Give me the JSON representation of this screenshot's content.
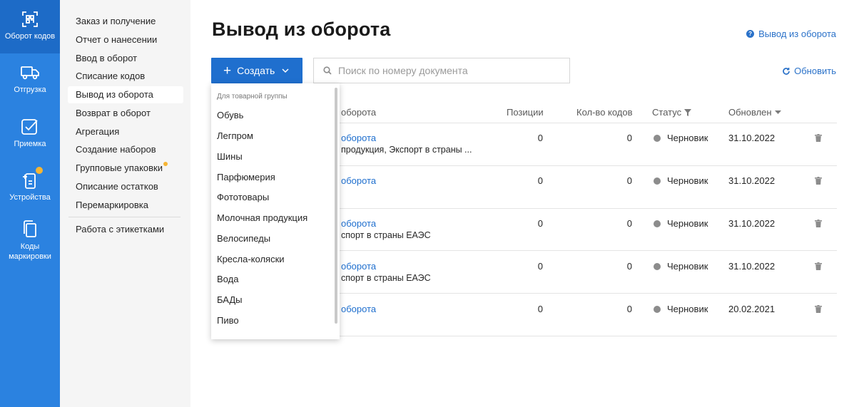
{
  "rail": {
    "items": [
      {
        "label": "Оборот кодов",
        "icon": "qr-scan-icon"
      },
      {
        "label": "Отгрузка",
        "icon": "truck-icon"
      },
      {
        "label": "Приемка",
        "icon": "checkbox-icon"
      },
      {
        "label": "Устройства",
        "icon": "device-icon"
      },
      {
        "label_line1": "Коды",
        "label_line2": "маркировки",
        "icon": "copy-icon"
      }
    ]
  },
  "subnav": {
    "items": [
      "Заказ и получение",
      "Отчет о нанесении",
      "Ввод в оборот",
      "Списание кодов",
      "Вывод из оборота",
      "Возврат в оборот",
      "Агрегация",
      "Создание наборов",
      "Групповые упаковки",
      "Описание остатков",
      "Перемаркировка",
      "Работа с этикетками"
    ],
    "active": "Вывод из оборота"
  },
  "header": {
    "title": "Вывод из оборота",
    "help_link": "Вывод из оборота"
  },
  "toolbar": {
    "create_label": "Создать",
    "search_placeholder": "Поиск по номеру документа",
    "refresh_label": "Обновить"
  },
  "table": {
    "columns": {
      "type": "оборота",
      "positions": "Позиции",
      "codes_count": "Кол-во кодов",
      "status": "Статус",
      "updated": "Обновлен"
    },
    "rows": [
      {
        "title": "оборота",
        "subtitle": "продукция, Экспорт в страны ...",
        "positions": "0",
        "codes": "0",
        "status": "Черновик",
        "updated": "31.10.2022"
      },
      {
        "title": "оборота",
        "subtitle": "",
        "positions": "0",
        "codes": "0",
        "status": "Черновик",
        "updated": "31.10.2022"
      },
      {
        "title": "оборота",
        "subtitle": "спорт в страны ЕАЭС",
        "positions": "0",
        "codes": "0",
        "status": "Черновик",
        "updated": "31.10.2022"
      },
      {
        "title": "оборота",
        "subtitle": "спорт в страны ЕАЭС",
        "positions": "0",
        "codes": "0",
        "status": "Черновик",
        "updated": "31.10.2022"
      },
      {
        "title": "оборота",
        "subtitle": "",
        "positions": "0",
        "codes": "0",
        "status": "Черновик",
        "updated": "20.02.2021"
      }
    ]
  },
  "dropdown": {
    "header": "Для товарной группы",
    "items": [
      "Обувь",
      "Легпром",
      "Шины",
      "Парфюмерия",
      "Фототовары",
      "Молочная продукция",
      "Велосипеды",
      "Кресла-коляски",
      "Вода",
      "БАДы",
      "Пиво"
    ]
  },
  "colors": {
    "rail": "#2b82e0",
    "primary": "#1f6fce",
    "badge": "#f6b533",
    "status_draft": "#8c8c8c"
  }
}
